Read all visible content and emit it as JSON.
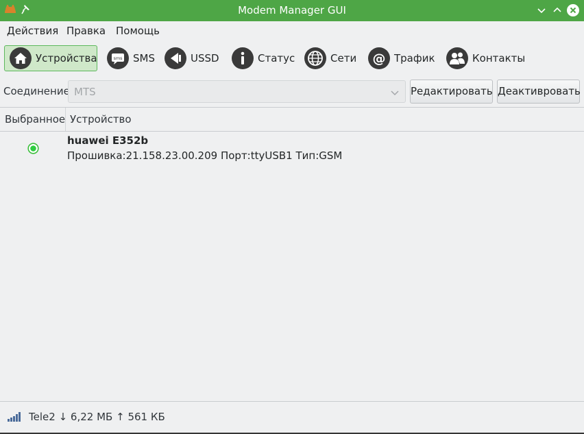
{
  "window": {
    "title": "Modem Manager GUI",
    "accent_color": "#4ea646"
  },
  "menu": {
    "items": [
      "Действия",
      "Правка",
      "Помощь"
    ]
  },
  "toolbar": {
    "buttons": [
      {
        "label": "Устройства",
        "icon": "home-icon",
        "active": true
      },
      {
        "label": "SMS",
        "icon": "sms-icon",
        "active": false
      },
      {
        "label": "USSD",
        "icon": "ussd-icon",
        "active": false
      },
      {
        "label": "Статус",
        "icon": "info-icon",
        "active": false
      },
      {
        "label": "Сети",
        "icon": "globe-icon",
        "active": false
      },
      {
        "label": "Трафик",
        "icon": "at-icon",
        "active": false
      },
      {
        "label": "Контакты",
        "icon": "contacts-icon",
        "active": false
      }
    ]
  },
  "connection": {
    "label": "Соединение",
    "value": "MTS",
    "edit_button": "Редактировать",
    "deactivate_button": "Деактивровать"
  },
  "table": {
    "columns": [
      "Выбранное",
      "Устройство"
    ],
    "rows": [
      {
        "selected": true,
        "name": "huawei E352b",
        "details": "Прошивка:21.158.23.00.209 Порт:ttyUSB1 Тип:GSM"
      }
    ]
  },
  "status": {
    "operator": "Tele2",
    "down": "↓ 6,22 МБ",
    "up": "↑ 561 КБ"
  }
}
